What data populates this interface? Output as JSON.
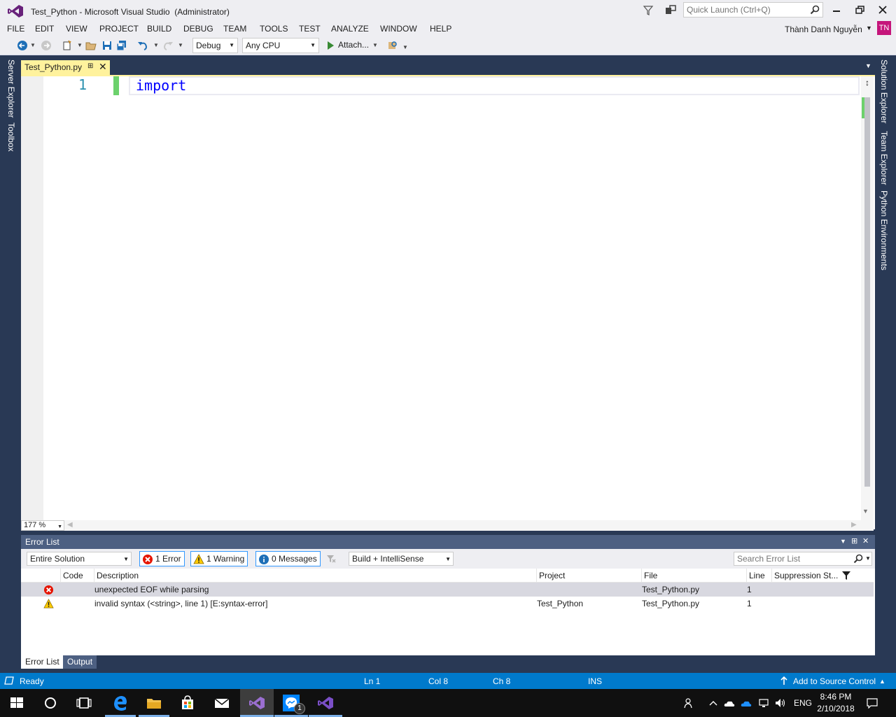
{
  "window": {
    "title": "Test_Python - Microsoft Visual Studio  (Administrator)",
    "quick_launch_placeholder": "Quick Launch (Ctrl+Q)",
    "user_name": "Thành Danh Nguyễn",
    "user_initials": "TN",
    "avatar_color": "#c5157b"
  },
  "menu": [
    "FILE",
    "EDIT",
    "VIEW",
    "PROJECT",
    "BUILD",
    "DEBUG",
    "TEAM",
    "TOOLS",
    "TEST",
    "ANALYZE",
    "WINDOW",
    "HELP"
  ],
  "toolbar": {
    "configuration": "Debug",
    "platform": "Any CPU",
    "attach_label": "Attach..."
  },
  "left_rail": [
    "Server Explorer",
    "Toolbox"
  ],
  "right_rail": [
    "Solution Explorer",
    "Team Explorer",
    "Python Environments"
  ],
  "document": {
    "tab_title": "Test_Python.py",
    "line_number": "1",
    "code": "import",
    "zoom": "177 %"
  },
  "error_list": {
    "title": "Error List",
    "scope": "Entire Solution",
    "errors_label": "1 Error",
    "warnings_label": "1 Warning",
    "messages_label": "0 Messages",
    "source": "Build + IntelliSense",
    "search_placeholder": "Search Error List",
    "columns": {
      "code": "Code",
      "description": "Description",
      "project": "Project",
      "file": "File",
      "line": "Line",
      "suppression": "Suppression St..."
    },
    "rows": [
      {
        "severity": "error",
        "code": "",
        "description": "unexpected EOF while parsing",
        "project": "",
        "file": "Test_Python.py",
        "line": "1",
        "suppression": ""
      },
      {
        "severity": "warning",
        "code": "",
        "description": "invalid syntax (<string>, line 1) [E:syntax-error]",
        "project": "Test_Python",
        "file": "Test_Python.py",
        "line": "1",
        "suppression": ""
      }
    ]
  },
  "bottom_tabs": [
    "Error List",
    "Output"
  ],
  "status": {
    "ready": "Ready",
    "ln": "Ln 1",
    "col": "Col 8",
    "ch": "Ch 8",
    "mode": "INS",
    "source_control": "Add to Source Control",
    "accent": "#007acc"
  },
  "taskbar": {
    "lang": "ENG",
    "time": "8:46 PM",
    "date": "2/10/2018",
    "messenger_badge": "1"
  }
}
